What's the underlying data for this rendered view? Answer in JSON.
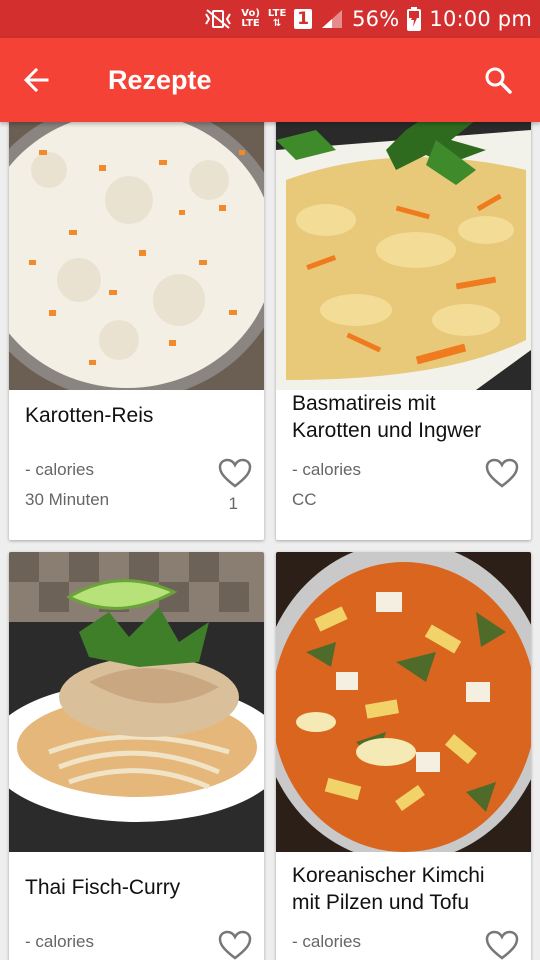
{
  "status_bar": {
    "vol_lte_top": "Vo)",
    "vol_lte_bottom": "LTE",
    "lte_label": "LTE",
    "sim_number": "1",
    "battery_percent": "56%",
    "time": "10:00 pm"
  },
  "app_bar": {
    "title": "Rezepte",
    "back_icon": "arrow-left-icon",
    "search_icon": "search-icon"
  },
  "colors": {
    "status_bar": "#d32f2f",
    "app_bar": "#f44336",
    "background": "#eeeeee"
  },
  "recipes": [
    {
      "name": "Karotten-Reis",
      "calories": "- calories",
      "meta": "30 Minuten",
      "likes": "1",
      "image": "carrot-rice"
    },
    {
      "name": "Basmatireis mit Karotten und Ingwer",
      "calories": "- calories",
      "meta": "CC",
      "likes": "",
      "image": "basmati-rice"
    },
    {
      "name": "Thai Fisch-Curry",
      "calories": "- calories",
      "meta": "",
      "likes": "",
      "image": "thai-fish-curry"
    },
    {
      "name": "Koreanischer Kimchi mit Pilzen und Tofu",
      "calories": "- calories",
      "meta": "",
      "likes": "",
      "image": "kimchi-tofu"
    }
  ]
}
